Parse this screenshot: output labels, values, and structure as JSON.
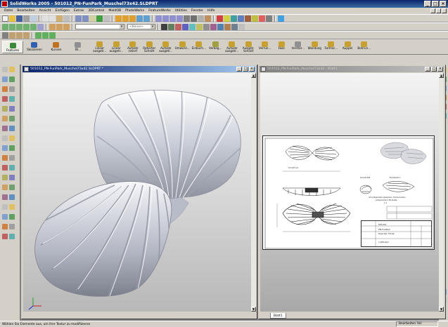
{
  "window": {
    "title": "SolidWorks 2005 - 501012_PN-FunPark_Muschel73x42.SLDPRT",
    "buttons": [
      "_",
      "□",
      "×"
    ]
  },
  "menu": {
    "items": [
      "Datei",
      "Bearbeiten",
      "Ansicht",
      "Einfügen",
      "Extras",
      "3DControl",
      "MoldOB",
      "PhotoWorks",
      "FeatureWorks",
      "Utilities",
      "Fenster",
      "Hilfe"
    ]
  },
  "toolbar": {
    "combo_left": "",
    "combo_right": "<Keine>"
  },
  "features_tabs": [
    {
      "label": "Features",
      "color": "#3a8a3a"
    },
    {
      "label": "Skizzieren",
      "color": "#3060b0"
    },
    {
      "label": "Kurven",
      "color": "#c07020"
    },
    {
      "label": "Bl...",
      "color": "#909090"
    }
  ],
  "feature_buttons": [
    {
      "label": "Linear ausgetr...",
      "color": "#c8a030"
    },
    {
      "label": "Linear ausgetr...",
      "color": "#c8a030"
    },
    {
      "label": "Aufsatz rotiert",
      "color": "#c8a030"
    },
    {
      "label": "Rotierter Schnitt",
      "color": "#c8a030"
    },
    {
      "label": "Aufsatz ausgetr...",
      "color": "#c8a030"
    },
    {
      "label": "Umwickl...",
      "color": "#c8a030"
    },
    {
      "label": "Einbuch...",
      "color": "#c8a030"
    },
    {
      "label": "Verbeg...",
      "color": "#a0a040"
    },
    {
      "label": "Aufsatz ausgetr...",
      "color": "#c8a030"
    },
    {
      "label": "Ausgetr. Schnitt",
      "color": "#c8a030"
    },
    {
      "label": "Verrun...",
      "color": "#c8a030"
    },
    {
      "label": "Fase",
      "color": "#c8a030"
    },
    {
      "label": "Verstär...",
      "color": "#909090"
    },
    {
      "label": "Wandung",
      "color": "#c8a030"
    },
    {
      "label": "Formsc...",
      "color": "#c8a030"
    },
    {
      "label": "Kuppel",
      "color": "#c8a030"
    },
    {
      "label": "Bohrun...",
      "color": "#c8a030"
    }
  ],
  "doc_part": {
    "title": "501012_PN-FunPark_Muschel73x42.SLDPRT *",
    "buttons": [
      "_",
      "□",
      "×"
    ]
  },
  "doc_drawing": {
    "title": "501012_PN-FunPark_Muschel73x42 - Blatt1",
    "buttons": [
      "_",
      "□",
      "×"
    ],
    "sheet_tab": "Blatt1",
    "notes": {
      "section_a": "Schnitt A-A",
      "section_b": "Schnitt B-B",
      "detail": "Einzelheit C",
      "material_note_1": "ohne Bearbeitungskanten, Kantenradien",
      "material_note_2": "entsprechend 3D-Daten",
      "scale_label": "1:1",
      "drawing_number": "501012",
      "title_1": "PN-FunPark",
      "title_2": "Muschel 73x42",
      "sheet_label": "1-DM-012"
    }
  },
  "status": {
    "left": "Wählen Sie Elemente aus, um ihre Textur zu modifizieren",
    "right": "Bearbeiten Teil"
  },
  "colors": {
    "titlebar_active": "#0a246a",
    "titlebar_inactive": "#808080",
    "chrome": "#d4d0c8",
    "feature_icon": "#c8a030"
  }
}
